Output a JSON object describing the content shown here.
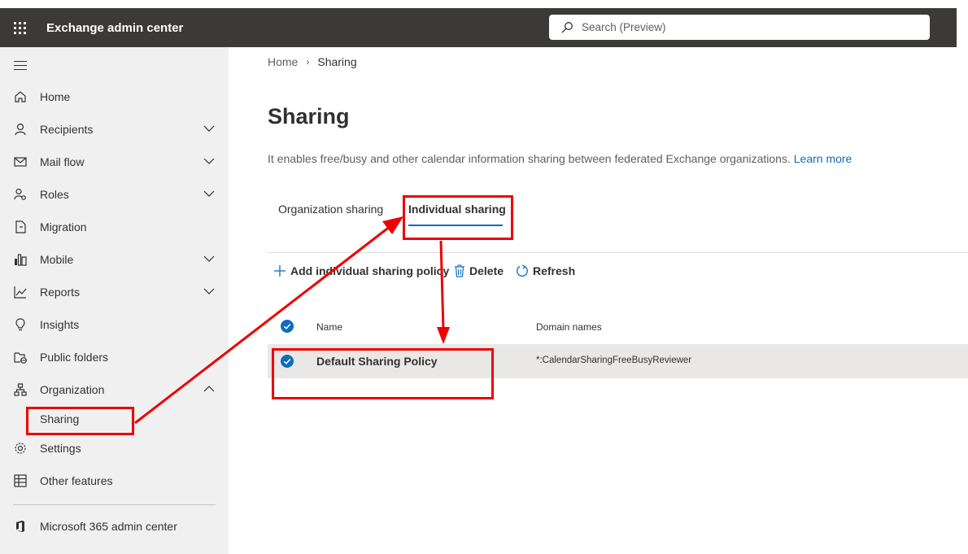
{
  "header": {
    "app_title": "Exchange admin center",
    "search_placeholder": "Search (Preview)"
  },
  "sidebar": {
    "items": [
      {
        "label": "Home",
        "icon": "home-icon"
      },
      {
        "label": "Recipients",
        "icon": "person-icon"
      },
      {
        "label": "Mail flow",
        "icon": "mail-icon"
      },
      {
        "label": "Roles",
        "icon": "roles-icon"
      },
      {
        "label": "Migration",
        "icon": "migration-icon"
      },
      {
        "label": "Mobile",
        "icon": "mobile-icon"
      },
      {
        "label": "Reports",
        "icon": "reports-icon"
      },
      {
        "label": "Insights",
        "icon": "lightbulb-icon"
      },
      {
        "label": "Public folders",
        "icon": "public-folders-icon"
      },
      {
        "label": "Organization",
        "icon": "organization-icon"
      },
      {
        "label": "Sharing",
        "icon": ""
      },
      {
        "label": "Settings",
        "icon": "gear-icon"
      },
      {
        "label": "Other features",
        "icon": "grid-icon"
      },
      {
        "label": "Microsoft 365 admin center",
        "icon": "office-icon"
      }
    ]
  },
  "breadcrumb": {
    "home": "Home",
    "current": "Sharing"
  },
  "page": {
    "title": "Sharing",
    "description": "It enables free/busy and other calendar information sharing between federated Exchange organizations.",
    "learn_more": "Learn more"
  },
  "tabs": {
    "organization": "Organization sharing",
    "individual": "Individual sharing"
  },
  "commands": {
    "add": "Add individual sharing policy",
    "delete": "Delete",
    "refresh": "Refresh"
  },
  "table": {
    "columns": [
      "Name",
      "Domain names"
    ],
    "rows": [
      {
        "name": "Default Sharing Policy",
        "domains": "*:CalendarSharingFreeBusyReviewer"
      }
    ]
  },
  "colors": {
    "topbar": "#3b3a39",
    "accent": "#0f6cbd",
    "annotation": "#ee0000"
  }
}
